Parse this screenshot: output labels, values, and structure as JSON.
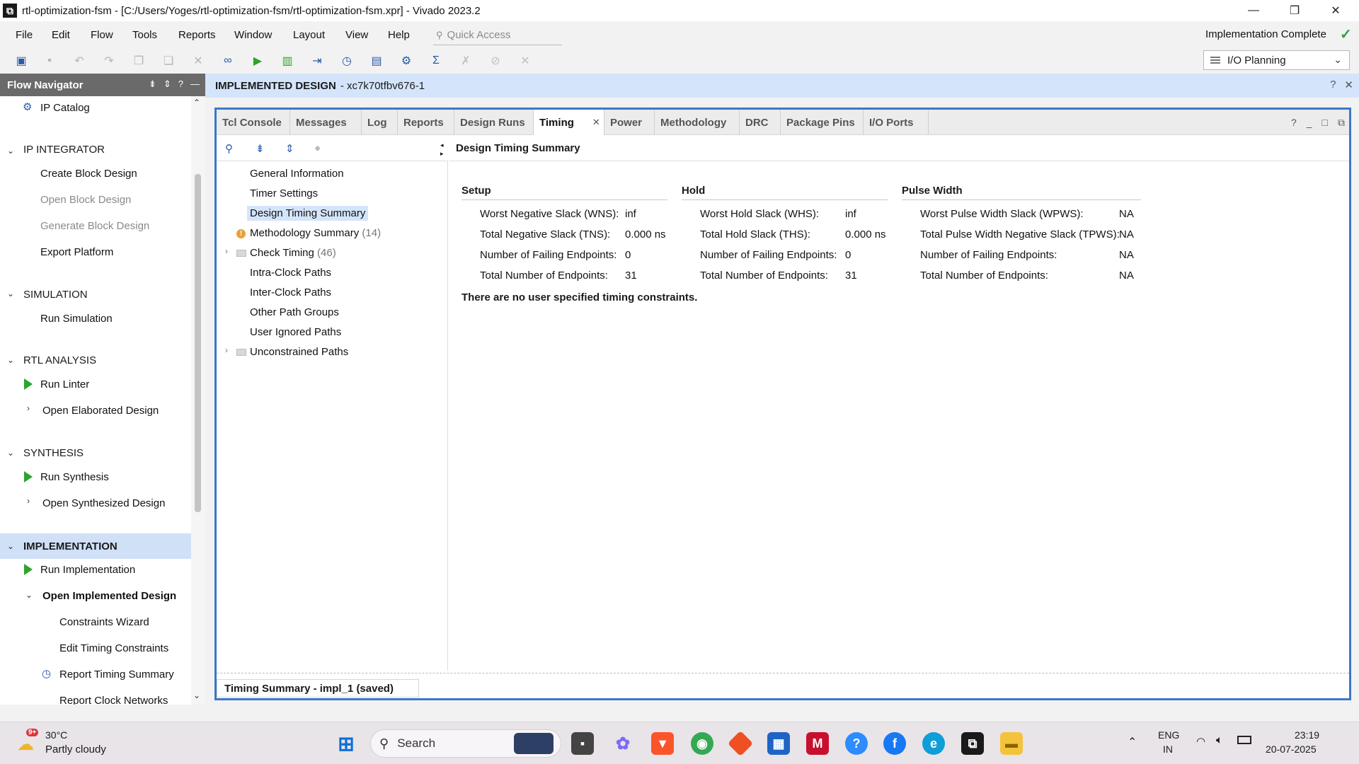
{
  "titlebar": {
    "title": "rtl-optimization-fsm - [C:/Users/Yoges/rtl-optimization-fsm/rtl-optimization-fsm.xpr] - Vivado 2023.2",
    "minimize": "—",
    "maximize": "❐",
    "close": "✕"
  },
  "menubar": {
    "items": [
      "File",
      "Edit",
      "Flow",
      "Tools",
      "Reports",
      "Window",
      "Layout",
      "View",
      "Help"
    ],
    "quick_access_placeholder": "Quick Access",
    "status": "Implementation Complete"
  },
  "layout_select": {
    "value": "I/O Planning"
  },
  "flow_navigator": {
    "title": "Flow Navigator",
    "items": {
      "ip_catalog": "IP Catalog",
      "ip_integrator": "IP INTEGRATOR",
      "create_block_design": "Create Block Design",
      "open_block_design": "Open Block Design",
      "generate_block_design": "Generate Block Design",
      "export_platform": "Export Platform",
      "simulation": "SIMULATION",
      "run_simulation": "Run Simulation",
      "rtl_analysis": "RTL ANALYSIS",
      "run_linter": "Run Linter",
      "open_elaborated_design": "Open Elaborated Design",
      "synthesis": "SYNTHESIS",
      "run_synthesis": "Run Synthesis",
      "open_synthesized_design": "Open Synthesized Design",
      "implementation": "IMPLEMENTATION",
      "run_implementation": "Run Implementation",
      "open_implemented_design": "Open Implemented Design",
      "constraints_wizard": "Constraints Wizard",
      "edit_timing_constraints": "Edit Timing Constraints",
      "report_timing_summary": "Report Timing Summary",
      "report_clock_networks": "Report Clock Networks"
    }
  },
  "design_header": {
    "label": "IMPLEMENTED DESIGN",
    "part": "- xc7k70tfbv676-1"
  },
  "tabs": [
    "Tcl Console",
    "Messages",
    "Log",
    "Reports",
    "Design Runs",
    "Timing",
    "Power",
    "Methodology",
    "DRC",
    "Package Pins",
    "I/O Ports"
  ],
  "tree": {
    "general_information": "General Information",
    "timer_settings": "Timer Settings",
    "design_timing_summary": "Design Timing Summary",
    "methodology_summary": "Methodology Summary",
    "methodology_count": "(14)",
    "check_timing": "Check Timing",
    "check_timing_count": "(46)",
    "intra_clock_paths": "Intra-Clock Paths",
    "inter_clock_paths": "Inter-Clock Paths",
    "other_path_groups": "Other Path Groups",
    "user_ignored_paths": "User Ignored Paths",
    "unconstrained_paths": "Unconstrained Paths"
  },
  "content": {
    "title": "Design Timing Summary",
    "setup": {
      "header": "Setup",
      "rows": [
        {
          "label": "Worst Negative Slack (WNS):",
          "value": "inf"
        },
        {
          "label": "Total Negative Slack (TNS):",
          "value": "0.000 ns"
        },
        {
          "label": "Number of Failing Endpoints:",
          "value": "0"
        },
        {
          "label": "Total Number of Endpoints:",
          "value": "31"
        }
      ]
    },
    "hold": {
      "header": "Hold",
      "rows": [
        {
          "label": "Worst Hold Slack (WHS):",
          "value": "inf"
        },
        {
          "label": "Total Hold Slack (THS):",
          "value": "0.000 ns"
        },
        {
          "label": "Number of Failing Endpoints:",
          "value": "0"
        },
        {
          "label": "Total Number of Endpoints:",
          "value": "31"
        }
      ]
    },
    "pulse": {
      "header": "Pulse Width",
      "rows": [
        {
          "label": "Worst Pulse Width Slack (WPWS):",
          "value": "NA"
        },
        {
          "label": "Total Pulse Width Negative Slack (TPWS):",
          "value": "NA"
        },
        {
          "label": "Number of Failing Endpoints:",
          "value": "NA"
        },
        {
          "label": "Total Number of Endpoints:",
          "value": "NA"
        }
      ]
    },
    "note": "There are no user specified timing constraints."
  },
  "bottom_tab": "Timing Summary - impl_1 (saved)",
  "taskbar": {
    "weather_temp": "30°C",
    "weather_desc": "Partly cloudy",
    "weather_badge": "9+",
    "search_placeholder": "Search",
    "lang": "ENG",
    "region": "IN",
    "time": "23:19",
    "date": "20-07-2025"
  },
  "colors": {
    "accent": "#3b78c8",
    "header_band": "#d4e5fb",
    "run_green": "#2ba52b",
    "warn": "#e8a13a"
  }
}
